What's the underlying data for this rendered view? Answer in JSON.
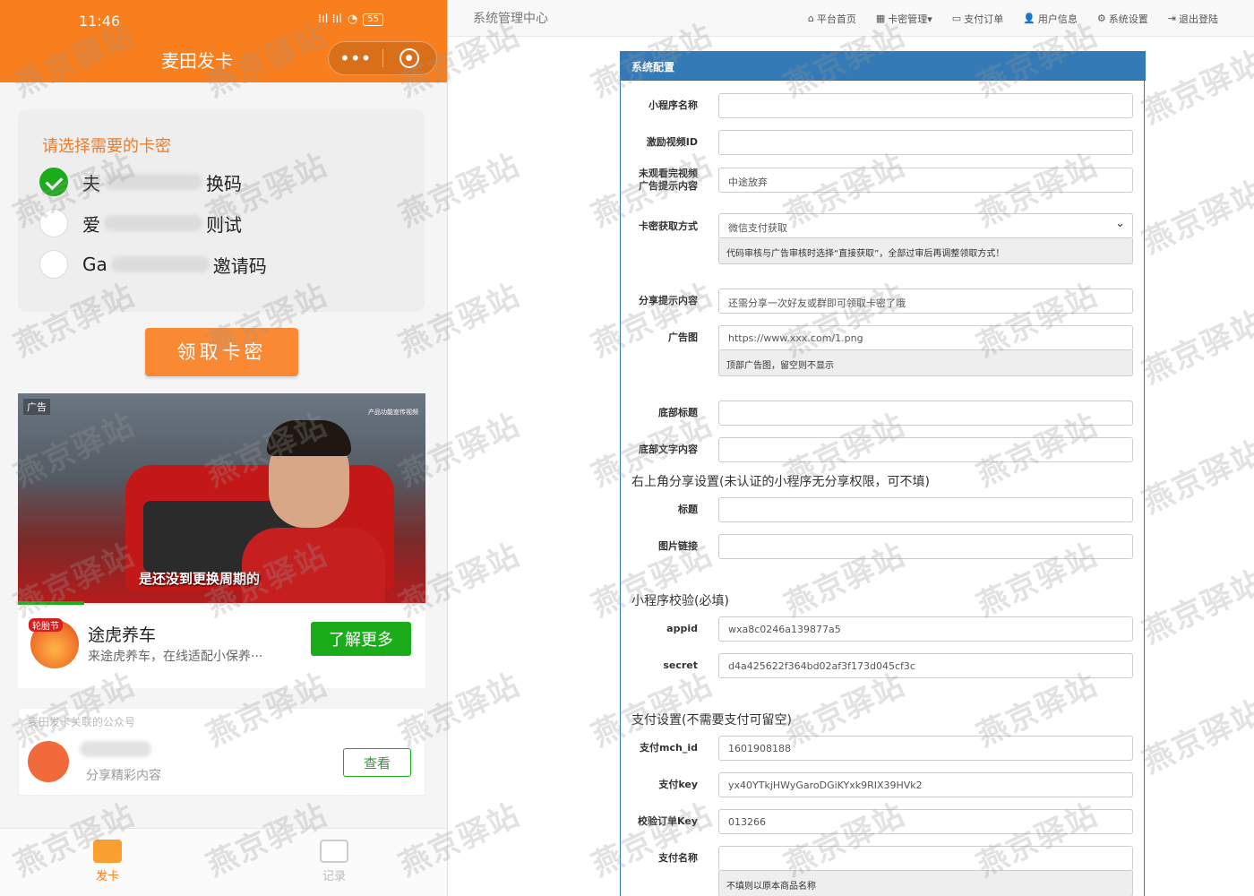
{
  "phone": {
    "status_time": "11:46",
    "status_signal": "⁞ıl ⁞ıl",
    "battery": "55",
    "app_title": "麦田发卡",
    "capsule_more": "•••",
    "select_title": "请选择需要的卡密",
    "options": [
      {
        "prefix": "夫",
        "suffix": "换码",
        "checked": true
      },
      {
        "prefix": "爱",
        "suffix": "则试",
        "checked": false
      },
      {
        "prefix": "Ga",
        "suffix": "邀请码",
        "checked": false
      }
    ],
    "claim_button": "领取卡密",
    "ad": {
      "tag": "广告",
      "topright_text": "产品功能宣传视频",
      "caption": "是还没到更换周期的"
    },
    "promo": {
      "logo_tag": "轮胎节",
      "name": "途虎养车",
      "desc": "来途虎养车，在线适配小保养···",
      "button": "了解更多"
    },
    "official_account": {
      "header": "麦田发卡关联的公众号",
      "desc": "分享精彩内容",
      "button": "查看"
    },
    "tabs": {
      "card": "发卡",
      "record": "记录"
    }
  },
  "admin": {
    "brand": "系统管理中心",
    "nav": [
      {
        "icon": "home-icon",
        "glyph": "⌂",
        "label": "平台首页"
      },
      {
        "icon": "grid-icon",
        "glyph": "▦",
        "label": "卡密管理▾"
      },
      {
        "icon": "card-icon",
        "glyph": "▭",
        "label": "支付订单"
      },
      {
        "icon": "user-icon",
        "glyph": "👤",
        "label": "用户信息"
      },
      {
        "icon": "gear-icon",
        "glyph": "⚙",
        "label": "系统设置"
      },
      {
        "icon": "logout-icon",
        "glyph": "⇥",
        "label": "退出登陆"
      }
    ],
    "panel_title": "系统配置",
    "fields": {
      "app_name": {
        "label": "小程序名称",
        "value": ""
      },
      "video_id": {
        "label": "激励视频ID",
        "value": ""
      },
      "unwatched_tip_l1": "未观看完视频",
      "unwatched_tip_l2": "广告提示内容",
      "unwatched_tip_value": "中途放弃",
      "fetch_mode": {
        "label": "卡密获取方式",
        "value": "微信支付获取",
        "hint": "代码审核与广告审核时选择“直接获取”，全部过审后再调整领取方式！"
      },
      "share_tip": {
        "label": "分享提示内容",
        "value": "还需分享一次好友或群即可领取卡密了哦"
      },
      "ad_image": {
        "label": "广告图",
        "value": "https://www.xxx.com/1.png",
        "hint": "顶部广告图，留空则不显示"
      },
      "footer_title": {
        "label": "底部标题",
        "value": ""
      },
      "footer_text": {
        "label": "底部文字内容",
        "value": ""
      }
    },
    "share_section": {
      "title": "右上角分享设置(未认证的小程序无分享权限，可不填)",
      "title_field": {
        "label": "标题",
        "value": ""
      },
      "image_field": {
        "label": "图片链接",
        "value": ""
      }
    },
    "verify_section": {
      "title": "小程序校验(必填)",
      "appid": {
        "label": "appid",
        "value": "wxa8c0246a139877a5"
      },
      "secret": {
        "label": "secret",
        "value": "d4a425622f364bd02af3f173d045cf3c"
      }
    },
    "pay_section": {
      "title": "支付设置(不需要支付可留空)",
      "mch_id": {
        "label": "支付mch_id",
        "value": "1601908188"
      },
      "pay_key": {
        "label": "支付key",
        "value": "yx40YTkjHWyGaroDGiKYxk9RIX39HVk2"
      },
      "order_key": {
        "label": "校验订单Key",
        "value": "013266"
      },
      "pay_name": {
        "label": "支付名称",
        "value": "",
        "hint": "不填则以原本商品名称"
      }
    }
  },
  "watermark": "燕京驿站"
}
